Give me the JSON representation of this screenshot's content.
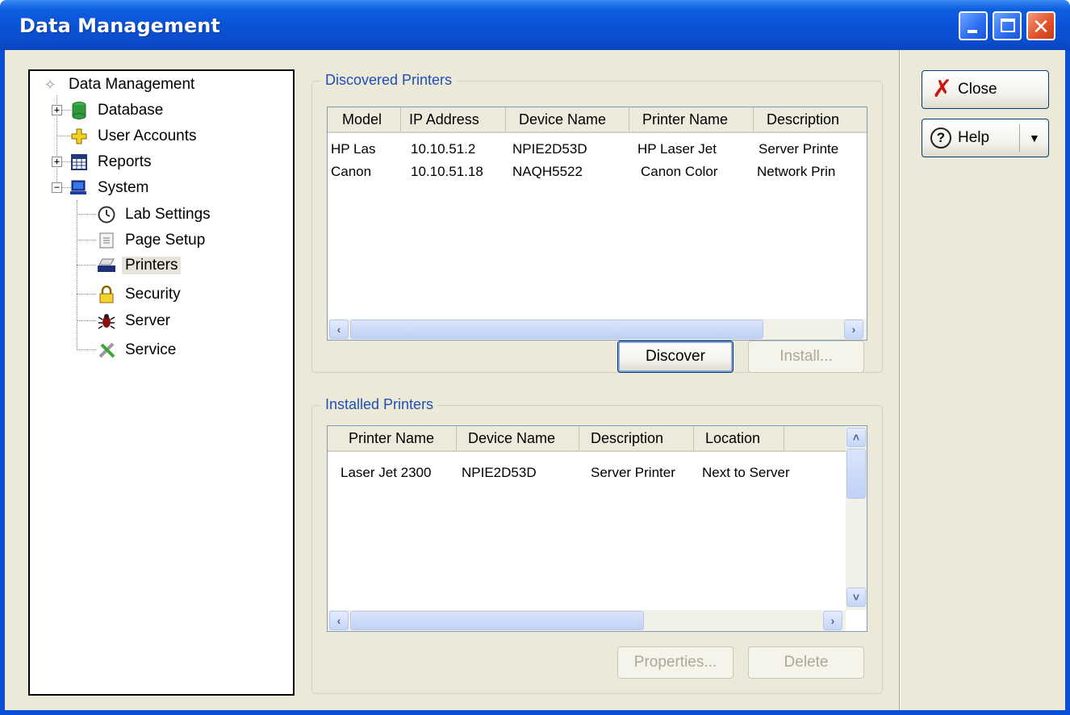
{
  "window": {
    "title": "Data Management"
  },
  "tree": {
    "root": "Data Management",
    "items": [
      {
        "label": "Database",
        "icon": "database-icon"
      },
      {
        "label": "User Accounts",
        "icon": "user-accounts-icon"
      },
      {
        "label": "Reports",
        "icon": "reports-icon"
      },
      {
        "label": "System",
        "icon": "system-icon"
      },
      {
        "label": "Lab Settings",
        "icon": "clock-icon"
      },
      {
        "label": "Page Setup",
        "icon": "page-setup-icon"
      },
      {
        "label": "Printers",
        "icon": "printer-icon"
      },
      {
        "label": "Security",
        "icon": "lock-icon"
      },
      {
        "label": "Server",
        "icon": "bug-icon"
      },
      {
        "label": "Service",
        "icon": "tools-icon"
      }
    ],
    "selected": "Printers"
  },
  "discovered": {
    "title": "Discovered Printers",
    "columns": [
      "Model",
      "IP Address",
      "Device Name",
      "Printer Name",
      "Description"
    ],
    "rows": [
      [
        "HP Las",
        "10.10.51.2",
        "NPIE2D53D",
        "HP Laser Jet",
        "Server Printe"
      ],
      [
        "Canon",
        "10.10.51.18",
        "NAQH5522",
        "Canon Color",
        "Network Prin"
      ]
    ],
    "discover_label": "Discover",
    "install_label": "Install..."
  },
  "installed": {
    "title": "Installed Printers",
    "columns": [
      "Printer Name",
      "Device Name",
      "Description",
      "Location"
    ],
    "rows": [
      [
        "Laser Jet 2300",
        "NPIE2D53D",
        "Server Printer",
        "Next to Server"
      ]
    ],
    "properties_label": "Properties...",
    "delete_label": "Delete"
  },
  "actions": {
    "close_label": "Close",
    "help_label": "Help"
  },
  "colors": {
    "titlebar": "#0a53d6",
    "face": "#ece9d8",
    "group_title": "#1f4fb6",
    "close_x": "#d0140e"
  }
}
